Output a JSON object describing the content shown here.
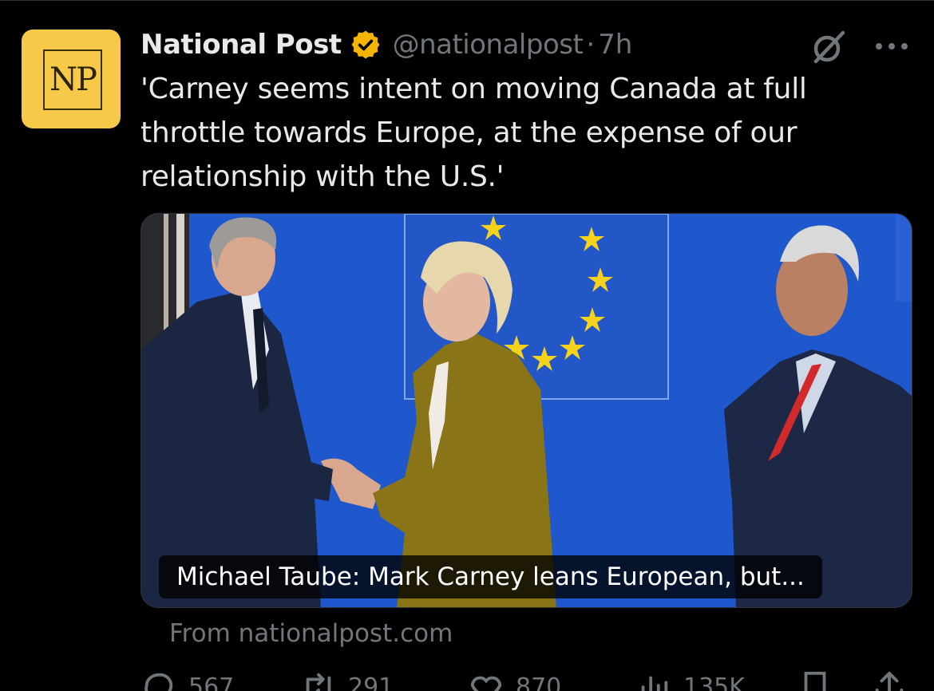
{
  "account": {
    "name": "National Post",
    "handle": "@nationalpost",
    "separator": "·",
    "time": "7h",
    "avatar_text": "NP",
    "badge_color": "#f4b400"
  },
  "tweet": {
    "text": "'Carney seems intent on moving Canada at full throttle towards Europe, at the expense of our relationship with the U.S.'"
  },
  "card": {
    "caption": "Michael Taube: Mark Carney leans European, but...",
    "source": "From nationalpost.com"
  },
  "actions": {
    "reply_count": "567",
    "retweet_count": "291",
    "like_count": "870",
    "views_count": "135K"
  },
  "icons": {
    "verified": "verified-badge-icon",
    "grok": "grok-icon",
    "more": "more-icon",
    "reply": "reply-icon",
    "retweet": "retweet-icon",
    "like": "heart-icon",
    "views": "views-icon",
    "bookmark": "bookmark-icon",
    "share": "share-icon"
  }
}
